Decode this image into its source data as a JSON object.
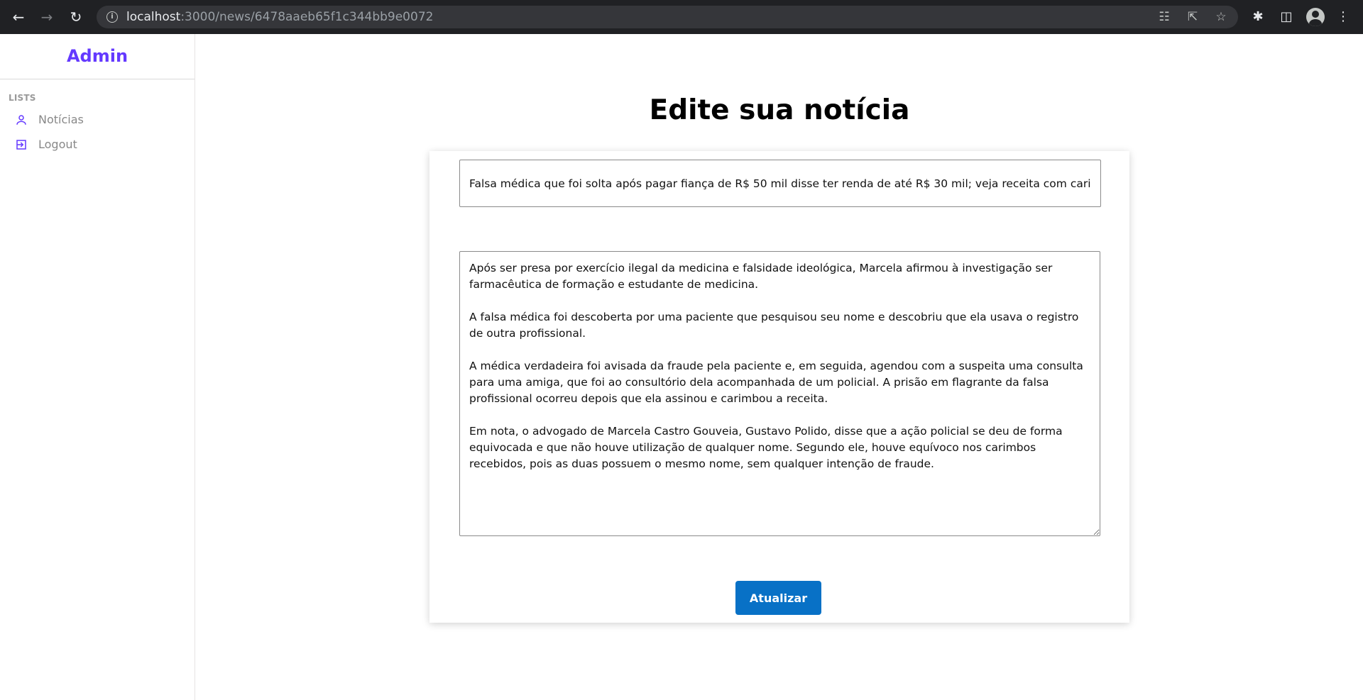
{
  "browser": {
    "url_host": "localhost",
    "url_path": ":3000/news/6478aaeb65f1c344bb9e0072"
  },
  "sidebar": {
    "brand": "Admin",
    "section_title": "LISTS",
    "items": [
      {
        "label": "Notícias",
        "icon": "user-icon"
      },
      {
        "label": "Logout",
        "icon": "logout-icon"
      }
    ]
  },
  "main": {
    "title": "Edite sua notícia",
    "form": {
      "title_value": "Falsa médica que foi solta após pagar fiança de R$ 50 mil disse ter renda de até R$ 30 mil; veja receita com carimbo falso",
      "body_value": "Após ser presa por exercício ilegal da medicina e falsidade ideológica, Marcela afirmou à investigação ser farmacêutica de formação e estudante de medicina.\n\nA falsa médica foi descoberta por uma paciente que pesquisou seu nome e descobriu que ela usava o registro de outra profissional.\n\nA médica verdadeira foi avisada da fraude pela paciente e, em seguida, agendou com a suspeita uma consulta para uma amiga, que foi ao consultório dela acompanhada de um policial. A prisão em flagrante da falsa profissional ocorreu depois que ela assinou e carimbou a receita.\n\nEm nota, o advogado de Marcela Castro Gouveia, Gustavo Polido, disse que a ação policial se deu de forma equivocada e que não houve utilização de qualquer nome. Segundo ele, houve equívoco nos carimbos recebidos, pois as duas possuem o mesmo nome, sem qualquer intenção de fraude.",
      "submit_label": "Atualizar"
    }
  },
  "colors": {
    "accent": "#6439ff",
    "button": "#0871c6",
    "chrome_bg": "#202124"
  }
}
